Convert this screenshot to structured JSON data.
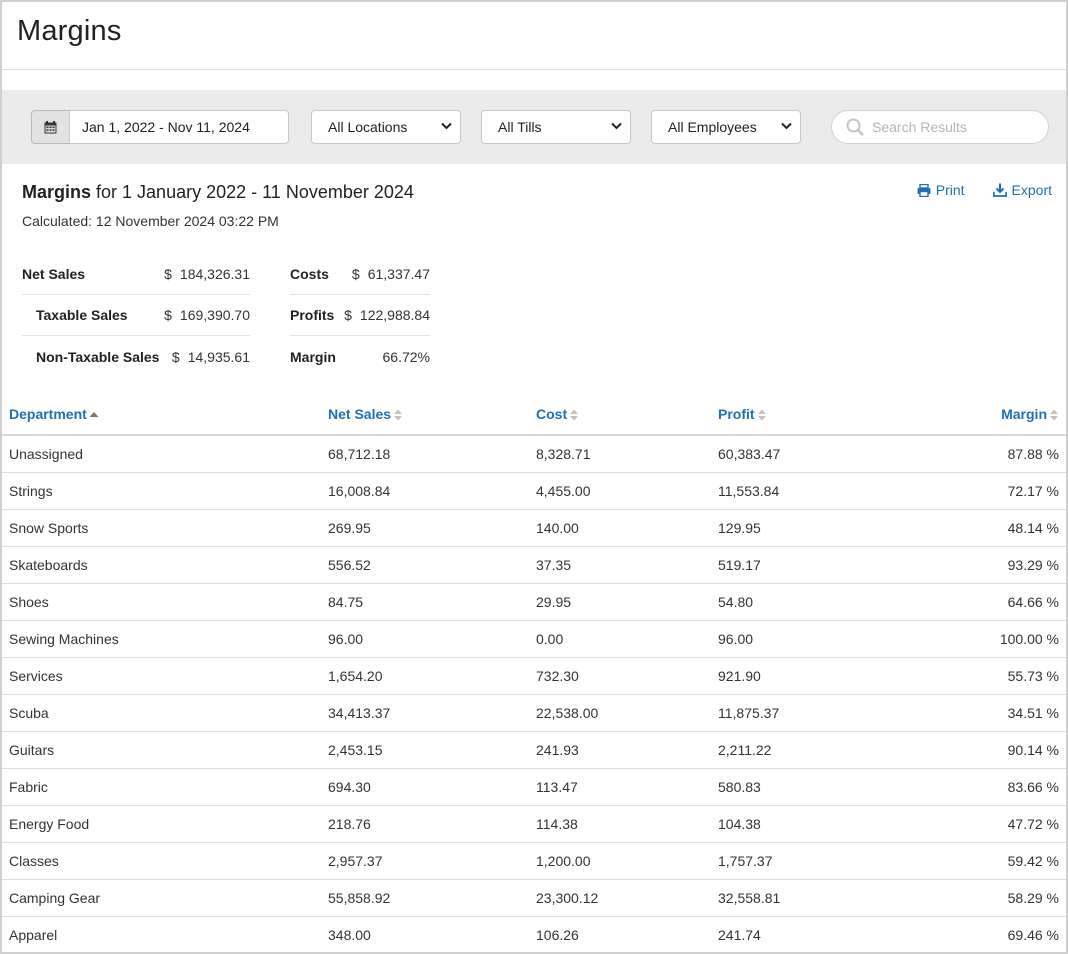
{
  "page": {
    "title": "Margins"
  },
  "filters": {
    "date_range": "Jan 1, 2022 - Nov 11, 2024",
    "location": "All Locations",
    "till": "All Tills",
    "employee": "All Employees",
    "search_placeholder": "Search Results"
  },
  "report": {
    "title_bold": "Margins",
    "title_rest": "for 1 January 2022 - 11 November 2024",
    "calculated": "Calculated: 12 November 2024 03:22 PM",
    "print_label": "Print",
    "export_label": "Export"
  },
  "summary": {
    "left": [
      {
        "label": "Net Sales",
        "currency": "$",
        "value": "184,326.31"
      },
      {
        "label": "Taxable Sales",
        "currency": "$",
        "value": "169,390.70"
      },
      {
        "label": "Non-Taxable Sales",
        "currency": "$",
        "value": "14,935.61"
      }
    ],
    "right": [
      {
        "label": "Costs",
        "currency": "$",
        "value": "61,337.47"
      },
      {
        "label": "Profits",
        "currency": "$",
        "value": "122,988.84"
      },
      {
        "label": "Margin",
        "currency": "",
        "value": "66.72%"
      }
    ]
  },
  "table": {
    "headers": {
      "department": "Department",
      "net_sales": "Net Sales",
      "cost": "Cost",
      "profit": "Profit",
      "margin": "Margin"
    },
    "sorted_column": "department",
    "sort_direction": "asc",
    "rows": [
      {
        "department": "Unassigned",
        "net_sales": "68,712.18",
        "cost": "8,328.71",
        "profit": "60,383.47",
        "margin": "87.88 %"
      },
      {
        "department": "Strings",
        "net_sales": "16,008.84",
        "cost": "4,455.00",
        "profit": "11,553.84",
        "margin": "72.17 %"
      },
      {
        "department": "Snow Sports",
        "net_sales": "269.95",
        "cost": "140.00",
        "profit": "129.95",
        "margin": "48.14 %"
      },
      {
        "department": "Skateboards",
        "net_sales": "556.52",
        "cost": "37.35",
        "profit": "519.17",
        "margin": "93.29 %"
      },
      {
        "department": "Shoes",
        "net_sales": "84.75",
        "cost": "29.95",
        "profit": "54.80",
        "margin": "64.66 %"
      },
      {
        "department": "Sewing Machines",
        "net_sales": "96.00",
        "cost": "0.00",
        "profit": "96.00",
        "margin": "100.00 %"
      },
      {
        "department": "Services",
        "net_sales": "1,654.20",
        "cost": "732.30",
        "profit": "921.90",
        "margin": "55.73 %"
      },
      {
        "department": "Scuba",
        "net_sales": "34,413.37",
        "cost": "22,538.00",
        "profit": "11,875.37",
        "margin": "34.51 %"
      },
      {
        "department": "Guitars",
        "net_sales": "2,453.15",
        "cost": "241.93",
        "profit": "2,211.22",
        "margin": "90.14 %"
      },
      {
        "department": "Fabric",
        "net_sales": "694.30",
        "cost": "113.47",
        "profit": "580.83",
        "margin": "83.66 %"
      },
      {
        "department": "Energy Food",
        "net_sales": "218.76",
        "cost": "114.38",
        "profit": "104.38",
        "margin": "47.72 %"
      },
      {
        "department": "Classes",
        "net_sales": "2,957.37",
        "cost": "1,200.00",
        "profit": "1,757.37",
        "margin": "59.42 %"
      },
      {
        "department": "Camping Gear",
        "net_sales": "55,858.92",
        "cost": "23,300.12",
        "profit": "32,558.81",
        "margin": "58.29 %"
      },
      {
        "department": "Apparel",
        "net_sales": "348.00",
        "cost": "106.26",
        "profit": "241.74",
        "margin": "69.46 %"
      }
    ]
  },
  "colors": {
    "accent": "#1f6fb5",
    "filter_bar": "#ebebeb"
  },
  "icons": {
    "calendar": "calendar-icon",
    "chevron": "chevron-down-icon",
    "search": "search-icon",
    "print": "print-icon",
    "export": "download-icon"
  }
}
